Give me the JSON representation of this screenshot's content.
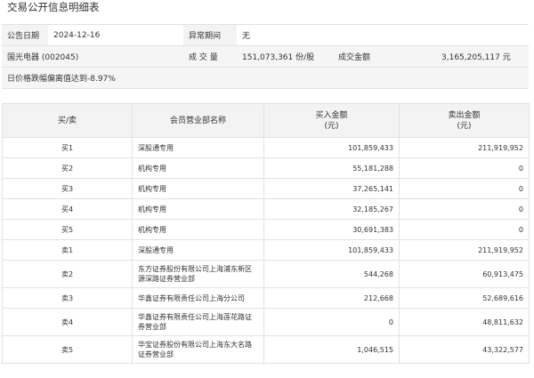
{
  "title": "交易公开信息明细表",
  "info": {
    "date_label": "公告日期",
    "date_value": "2024-12-16",
    "period_label": "异常期间",
    "period_value": "无",
    "stock": "国光电器 (002045)",
    "volume_label": "成 交 量",
    "volume_value": "151,073,361 份/股",
    "amount_label": "成交金额",
    "amount_value": "3,165,205,117 元",
    "note": "日价格跌幅偏离值达到-8.97%"
  },
  "table": {
    "headers": [
      "买/卖",
      "会员营业部名称",
      "买入金额\n(元)",
      "卖出金额\n(元)"
    ],
    "rows": [
      {
        "side": "买1",
        "name": "深股通专用",
        "buy": "101,859,433",
        "sell": "211,919,952"
      },
      {
        "side": "买2",
        "name": "机构专用",
        "buy": "55,181,288",
        "sell": "0"
      },
      {
        "side": "买3",
        "name": "机构专用",
        "buy": "37,265,141",
        "sell": "0"
      },
      {
        "side": "买4",
        "name": "机构专用",
        "buy": "32,185,267",
        "sell": "0"
      },
      {
        "side": "买5",
        "name": "机构专用",
        "buy": "30,691,383",
        "sell": "0"
      },
      {
        "side": "卖1",
        "name": "深股通专用",
        "buy": "101,859,433",
        "sell": "211,919,952"
      },
      {
        "side": "卖2",
        "name": "东方证券股份有限公司上海浦东新区源深路证券营业部",
        "buy": "544,268",
        "sell": "60,913,475"
      },
      {
        "side": "卖3",
        "name": "华鑫证券有限责任公司上海分公司",
        "buy": "212,668",
        "sell": "52,689,616"
      },
      {
        "side": "卖4",
        "name": "华鑫证券有限责任公司上海莲花路证券营业部",
        "buy": "0",
        "sell": "48,811,632"
      },
      {
        "side": "卖5",
        "name": "华宝证券股份有限公司上海东大名路证券营业部",
        "buy": "1,046,515",
        "sell": "43,322,577"
      }
    ]
  }
}
